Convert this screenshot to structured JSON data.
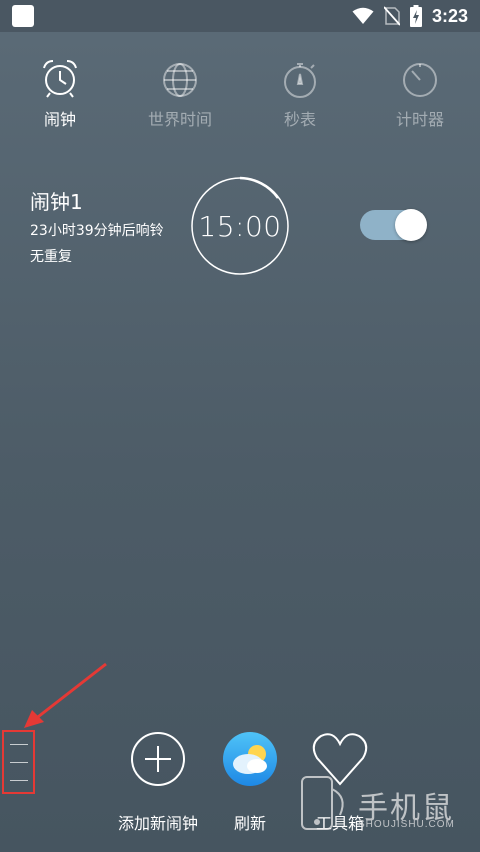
{
  "status_bar": {
    "time": "3:23",
    "icons": [
      "app-icon",
      "wifi-icon",
      "no-sim-icon",
      "battery-charging-icon"
    ]
  },
  "tabs": [
    {
      "label": "闹钟",
      "icon": "alarm-clock-icon",
      "active": true
    },
    {
      "label": "世界时间",
      "icon": "globe-icon",
      "active": false
    },
    {
      "label": "秒表",
      "icon": "stopwatch-icon",
      "active": false
    },
    {
      "label": "计时器",
      "icon": "timer-icon",
      "active": false
    }
  ],
  "alarm": {
    "name": "闹钟1",
    "countdown": "23小时39分钟后响铃",
    "repeat": "无重复",
    "time": "15:00",
    "enabled": true
  },
  "bottom_actions": [
    {
      "label": "添加新闹钟",
      "icon": "plus-circle-icon"
    },
    {
      "label": "刷新",
      "icon": "weather-refresh-icon"
    },
    {
      "label": "工具箱",
      "icon": "heart-icon"
    }
  ],
  "watermark": {
    "text": "手机鼠",
    "sub": "SHOUJISHU.COM"
  },
  "colors": {
    "background": "#55646f",
    "toggle_track": "#8fb2c8",
    "annotation": "#e53935"
  }
}
